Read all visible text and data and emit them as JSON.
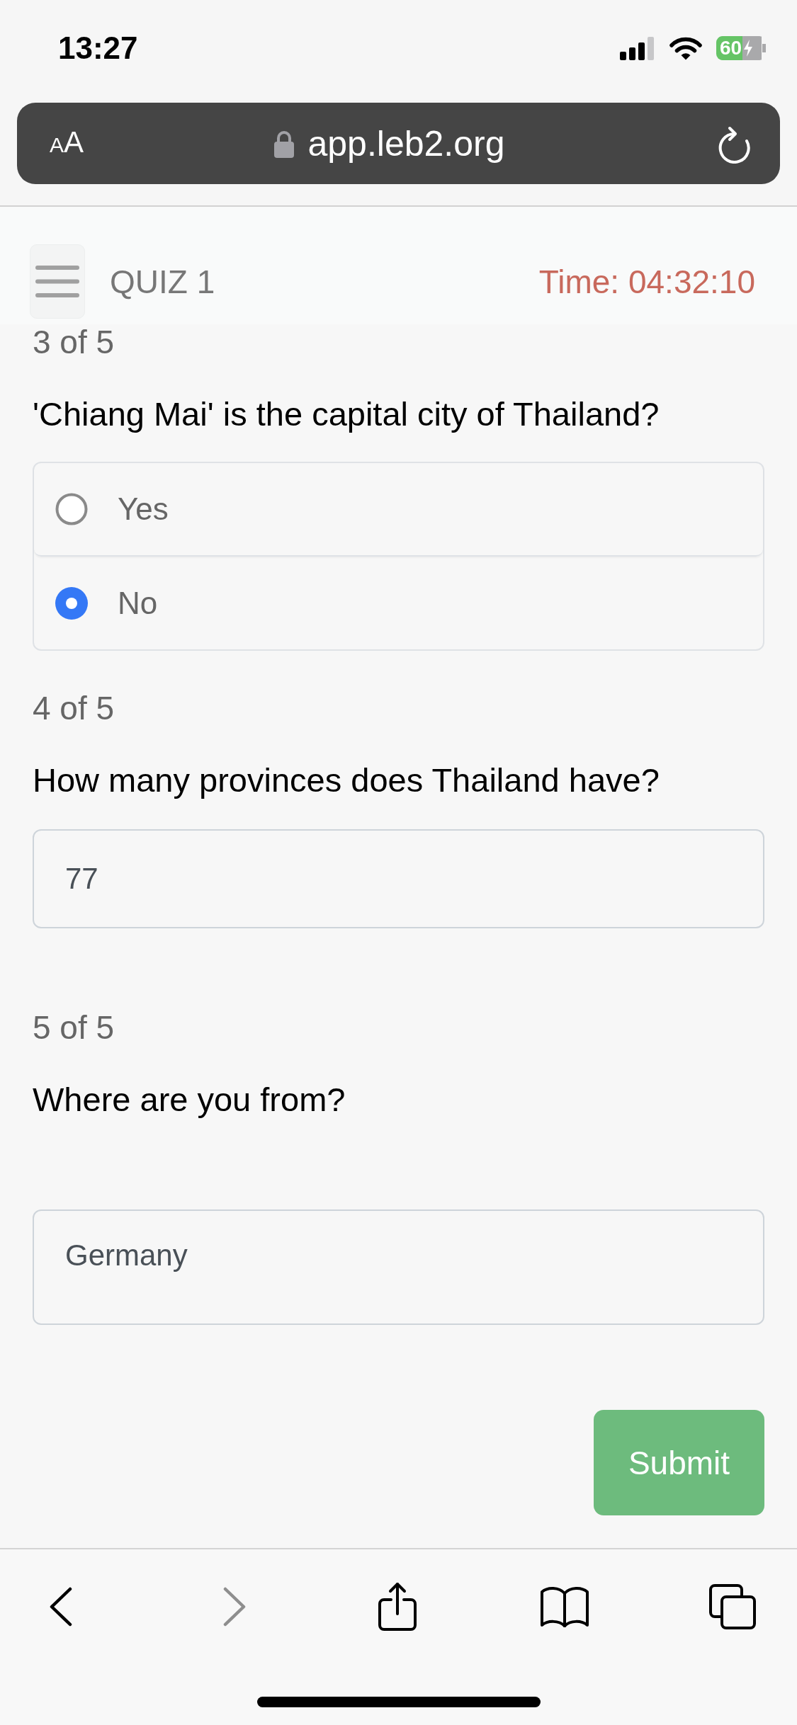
{
  "status_bar": {
    "time": "13:27",
    "battery": "60"
  },
  "address_bar": {
    "text_size_button": "AA",
    "url": "app.leb2.org"
  },
  "header": {
    "title": "QUIZ 1",
    "timer": "Time: 04:32:10"
  },
  "questions": [
    {
      "kind": "choice",
      "counter": "3 of 5",
      "text": "'Chiang Mai' is the capital city of Thailand?",
      "options": [
        {
          "label": "Yes",
          "selected": false
        },
        {
          "label": "No",
          "selected": true
        }
      ]
    },
    {
      "kind": "short",
      "counter": "4 of 5",
      "text": "How many provinces does Thailand have?",
      "value": "77"
    },
    {
      "kind": "long",
      "counter": "5 of 5",
      "text": "Where are you from?",
      "value": "Germany"
    }
  ],
  "submit_button": "Submit",
  "browser_toolbar": [
    {
      "kind": "back",
      "disabled": false
    },
    {
      "kind": "forward",
      "disabled": true
    },
    {
      "kind": "share",
      "disabled": false
    },
    {
      "kind": "bookmarks",
      "disabled": false
    },
    {
      "kind": "tabs",
      "disabled": false
    }
  ]
}
